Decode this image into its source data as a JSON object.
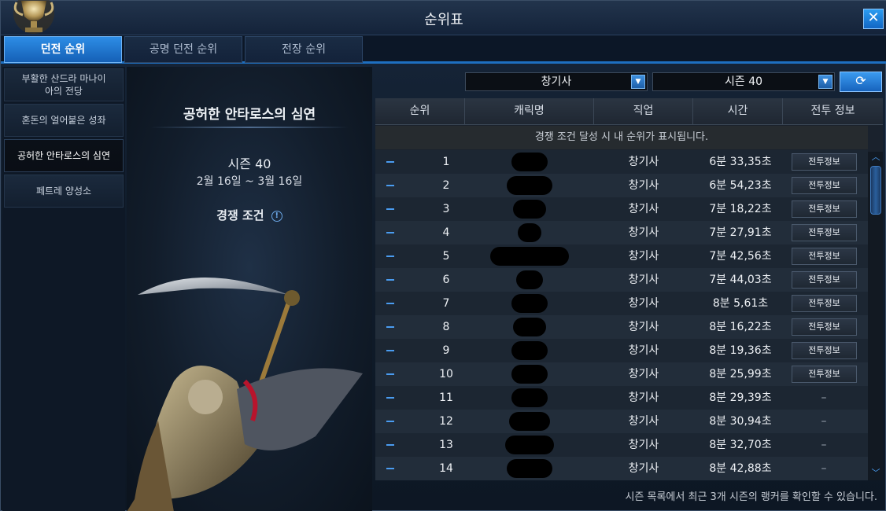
{
  "window": {
    "title": "순위표",
    "close_label": "✕"
  },
  "tabs": [
    {
      "label": "던전 순위",
      "active": true
    },
    {
      "label": "공명 던전 순위",
      "active": false
    },
    {
      "label": "전장 순위",
      "active": false
    }
  ],
  "sidebar": {
    "items": [
      {
        "label": "부활한 산드라 마나이아의 전당",
        "active": false
      },
      {
        "label": "혼돈의 얼어붙은 성좌",
        "active": false
      },
      {
        "label": "공허한 안타로스의 심연",
        "active": true
      },
      {
        "label": "페트레 양성소",
        "active": false
      }
    ]
  },
  "info": {
    "dungeon_name": "공허한 안타로스의 심연",
    "season": "시즌 40",
    "dates": "2월 16일 ~ 3월 16일",
    "condition_label": "경쟁 조건",
    "condition_icon": "!"
  },
  "filters": {
    "class_select": "창기사",
    "season_select": "시즌 40",
    "arrow_glyph": "▼",
    "refresh_glyph": "⟳"
  },
  "table": {
    "headers": [
      "순위",
      "캐릭명",
      "직업",
      "시간",
      "전투 정보"
    ],
    "notice": "경쟁 조건 달성 시 내 순위가 표시됩니다.",
    "rows": [
      {
        "rank": "1",
        "class": "창기사",
        "time": "6분 33,35초",
        "battle": "전투정보"
      },
      {
        "rank": "2",
        "class": "창기사",
        "time": "6분 54,23초",
        "battle": "전투정보"
      },
      {
        "rank": "3",
        "class": "창기사",
        "time": "7분 18,22초",
        "battle": "전투정보"
      },
      {
        "rank": "4",
        "class": "창기사",
        "time": "7분 27,91초",
        "battle": "전투정보"
      },
      {
        "rank": "5",
        "class": "창기사",
        "time": "7분 42,56초",
        "battle": "전투정보"
      },
      {
        "rank": "6",
        "class": "창기사",
        "time": "7분 44,03초",
        "battle": "전투정보"
      },
      {
        "rank": "7",
        "class": "창기사",
        "time": "8분 5,61초",
        "battle": "전투정보"
      },
      {
        "rank": "8",
        "class": "창기사",
        "time": "8분 16,22초",
        "battle": "전투정보"
      },
      {
        "rank": "9",
        "class": "창기사",
        "time": "8분 19,36초",
        "battle": "전투정보"
      },
      {
        "rank": "10",
        "class": "창기사",
        "time": "8분 25,99초",
        "battle": "전투정보"
      },
      {
        "rank": "11",
        "class": "창기사",
        "time": "8분 29,39초",
        "battle": "–"
      },
      {
        "rank": "12",
        "class": "창기사",
        "time": "8분 30,94초",
        "battle": "–"
      },
      {
        "rank": "13",
        "class": "창기사",
        "time": "8분 32,70초",
        "battle": "–"
      },
      {
        "rank": "14",
        "class": "창기사",
        "time": "8분 42,88초",
        "battle": "–"
      }
    ]
  },
  "footer": {
    "note": "시즌 목록에서 최근 3개 시즌의 랭커를 확인할 수 있습니다."
  },
  "colors": {
    "accent": "#2d8de6",
    "rank_dash": "#4a9cf0"
  }
}
